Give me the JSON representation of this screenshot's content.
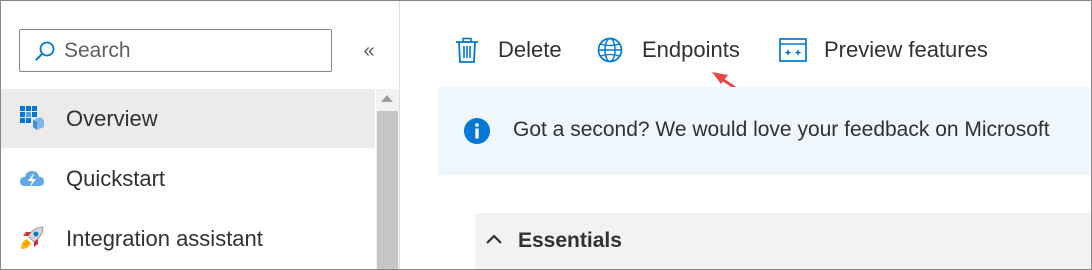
{
  "sidebar": {
    "search": {
      "placeholder": "Search",
      "value": ""
    },
    "collapse_label": "«",
    "items": [
      {
        "label": "Overview",
        "icon": "overview-icon",
        "active": true
      },
      {
        "label": "Quickstart",
        "icon": "cloud-bolt-icon",
        "active": false
      },
      {
        "label": "Integration assistant",
        "icon": "rocket-icon",
        "active": false
      }
    ]
  },
  "toolbar": {
    "delete_label": "Delete",
    "endpoints_label": "Endpoints",
    "preview_label": "Preview features"
  },
  "banner": {
    "message": "Got a second? We would love your feedback on Microsoft"
  },
  "essentials": {
    "label": "Essentials",
    "expanded": true
  },
  "colors": {
    "accent": "#0078d4",
    "arrow": "#e8474c",
    "banner_bg": "#eff6fc",
    "active_bg": "#edebe9"
  }
}
